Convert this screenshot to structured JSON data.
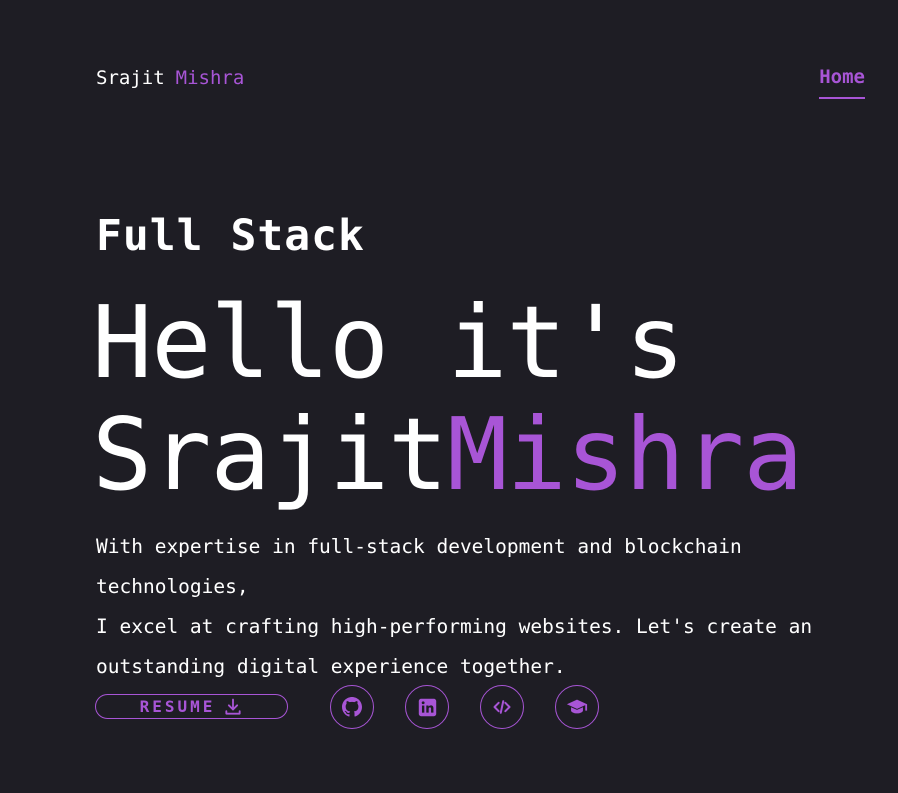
{
  "header": {
    "brand_first": "Srajit",
    "brand_last": "Mishra",
    "nav_home": "Home"
  },
  "hero": {
    "subtitle": "Full Stack",
    "headline_line1": "Hello it's",
    "headline_name_white": "Srajit",
    "headline_name_accent": "Mishra",
    "description": "With expertise in full-stack development and blockchain technologies,\nI excel at crafting high-performing websites. Let's create an\noutstanding digital experience together."
  },
  "actions": {
    "resume_label": "RESUME",
    "resume_icon": "download-icon",
    "socials": [
      {
        "icon": "github-icon"
      },
      {
        "icon": "linkedin-icon"
      },
      {
        "icon": "code-icon"
      },
      {
        "icon": "graduation-cap-icon"
      }
    ]
  },
  "colors": {
    "background": "#1e1d24",
    "accent": "#a855d6",
    "text": "#ffffff"
  }
}
